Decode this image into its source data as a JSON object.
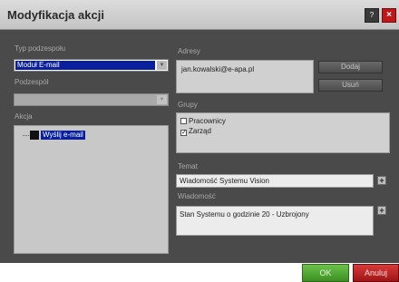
{
  "window": {
    "title": "Modyfikacja akcji",
    "help_icon": "help-icon",
    "help_label": "?",
    "close_icon": "close-icon",
    "close_label": "×"
  },
  "left": {
    "typ_label": "Typ podzespołu",
    "typ_value": "Moduł E-mail",
    "podzespol_label": "Podzespół",
    "podzespol_value": "",
    "akcja_label": "Akcja",
    "tree_item": "Wyślij e-mail",
    "tree_icon": "email-action-icon"
  },
  "right": {
    "adresy_label": "Adresy",
    "addresses": [
      "jan.kowalski@e-apa.pl"
    ],
    "add_button": "Dodaj",
    "remove_button": "Usuń",
    "grupy_label": "Grupy",
    "groups": [
      {
        "name": "Pracownicy",
        "checked": false
      },
      {
        "name": "Zarząd",
        "checked": true
      }
    ],
    "temat_label": "Temat",
    "temat_value": "Wiadomość Systemu Vision",
    "wiadomosc_label": "Wiadomość",
    "wiadomosc_value": "Stan Systemu o godzinie 20 - Uzbrojony",
    "plus_label": "+"
  },
  "footer": {
    "ok_button": "OK",
    "cancel_button": "Anuluj"
  },
  "colors": {
    "selection": "#0a1f9c",
    "ok": "#4aa82c",
    "cancel": "#c01818",
    "dialog_bg": "#4a4a4a"
  }
}
